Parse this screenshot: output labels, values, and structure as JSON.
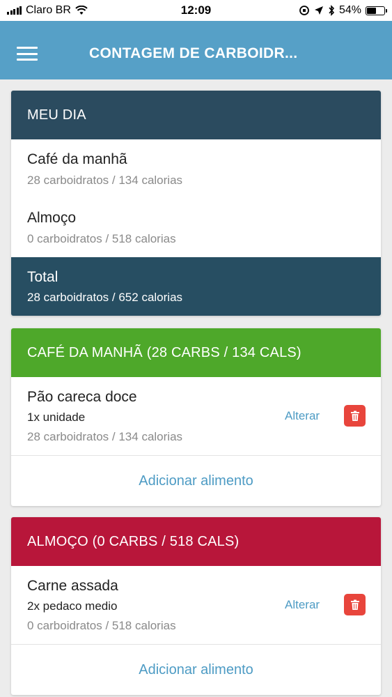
{
  "status_bar": {
    "carrier": "Claro BR",
    "time": "12:09",
    "battery": "54%",
    "battery_level": 0.54
  },
  "app_bar": {
    "title": "CONTAGEM DE CARBOIDR...",
    "menu_icon": "hamburger-menu-icon",
    "color": "#56a0c7"
  },
  "my_day": {
    "header": "MEU DIA",
    "header_color": "#2b4b5f",
    "meals": [
      {
        "name": "Café da manhã",
        "info": "28 carboidratos / 134 calorias"
      },
      {
        "name": "Almoço",
        "info": "0 carboidratos / 518 calorias"
      }
    ],
    "total": {
      "label": "Total",
      "info": "28 carboidratos / 652 calorias"
    }
  },
  "meal_sections": [
    {
      "header": "CAFÉ DA MANHÃ (28 CARBS / 134 CALS)",
      "color": "#4ea82a",
      "items": [
        {
          "name": "Pão careca doce",
          "quantity": "1x unidade",
          "info": "28 carboidratos / 134 calorias",
          "edit_label": "Alterar",
          "delete_icon": "trash-icon"
        }
      ],
      "add_label": "Adicionar alimento"
    },
    {
      "header": "ALMOÇO (0 CARBS / 518 CALS)",
      "color": "#b8163a",
      "items": [
        {
          "name": "Carne assada",
          "quantity": "2x pedaco medio",
          "info": "0 carboidratos / 518 calorias",
          "edit_label": "Alterar",
          "delete_icon": "trash-icon"
        }
      ],
      "add_label": "Adicionar alimento"
    }
  ]
}
